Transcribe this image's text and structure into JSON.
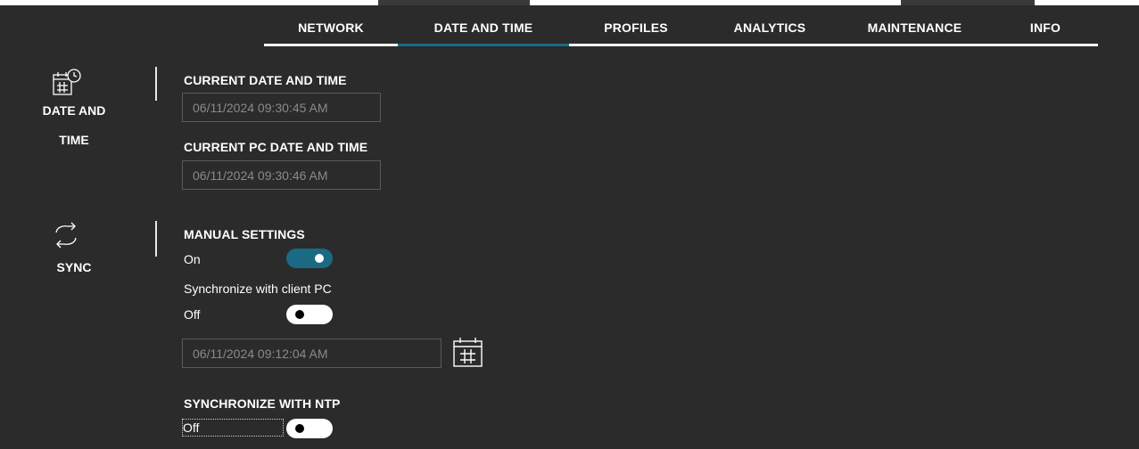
{
  "tabs": [
    {
      "label": "NETWORK",
      "active": false
    },
    {
      "label": "DATE AND TIME",
      "active": true
    },
    {
      "label": "PROFILES",
      "active": false
    },
    {
      "label": "ANALYTICS",
      "active": false
    },
    {
      "label": "MAINTENANCE",
      "active": false
    },
    {
      "label": "INFO",
      "active": false
    }
  ],
  "sections": {
    "datetime": {
      "icon": "calendar-clock-icon",
      "label_line1": "DATE AND",
      "label_line2": "TIME"
    },
    "sync": {
      "icon": "sync-icon",
      "label": "SYNC"
    }
  },
  "datetime": {
    "current_label": "CURRENT DATE AND TIME",
    "current_value": "06/11/2024 09:30:45 AM",
    "pc_label": "CURRENT PC DATE AND TIME",
    "pc_value": "06/11/2024 09:30:46 AM"
  },
  "sync": {
    "manual_label": "MANUAL SETTINGS",
    "manual_state": "On",
    "manual_on": true,
    "client_label": "Synchronize with client PC",
    "client_state": "Off",
    "client_on": false,
    "manual_datetime_value": "06/11/2024 09:12:04 AM",
    "ntp_label": "SYNCHRONIZE WITH NTP",
    "ntp_state": "Off",
    "ntp_on": false
  },
  "colors": {
    "accent": "#1a6a84",
    "background": "#2b2b2b",
    "field_border": "#5a5a5a",
    "field_text": "#8a8a8a"
  }
}
